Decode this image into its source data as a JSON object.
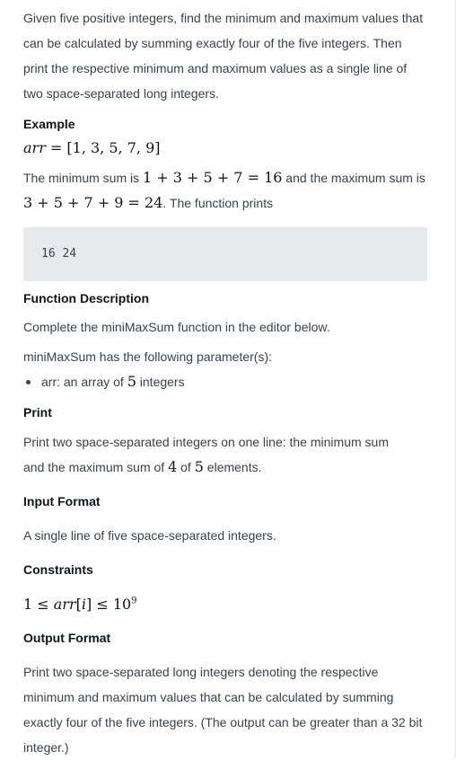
{
  "intro": "Given five positive integers, find the minimum and maximum values that can be calculated by summing exactly four of the five integers. Then print the respective minimum and maximum values as a single line of two space-separated long integers.",
  "example": {
    "heading": "Example",
    "arr_math_var": "arr",
    "arr_math_eq": " = [1, 3, 5, 7, 9]",
    "sum_text_1": "The minimum sum is ",
    "sum_math_1": "1 + 3 + 5 + 7 = 16",
    "sum_text_2": " and the maximum sum is",
    "sum_math_2": "3 + 5 + 7 + 9 = 24",
    "sum_text_3": ". The function prints",
    "output": "16 24"
  },
  "function_description": {
    "heading": "Function Description",
    "line1": "Complete the miniMaxSum function in the editor below.",
    "line2": "miniMaxSum has the following parameter(s):",
    "param_prefix": "arr: an array of ",
    "param_num": "5",
    "param_suffix": " integers"
  },
  "print": {
    "heading": "Print",
    "line_a": "Print two space-separated integers on one line: the minimum sum",
    "line_b_1": "and the maximum sum of ",
    "line_b_num1": "4",
    "line_b_2": " of ",
    "line_b_num2": "5",
    "line_b_3": " elements."
  },
  "input_format": {
    "heading": "Input Format",
    "text": "A single line of five space-separated integers."
  },
  "constraints": {
    "heading": "Constraints",
    "math_pre": "1 ≤ ",
    "math_var": "arr",
    "math_idx_open": "[",
    "math_idx": "i",
    "math_idx_close": "]",
    "math_post": " ≤ 10",
    "math_exp": "9"
  },
  "output_format": {
    "heading": "Output Format",
    "text": "Print two space-separated long integers denoting the respective minimum and maximum values that can be calculated by summing exactly four of the five integers. (The output can be greater than a 32 bit integer.)"
  }
}
